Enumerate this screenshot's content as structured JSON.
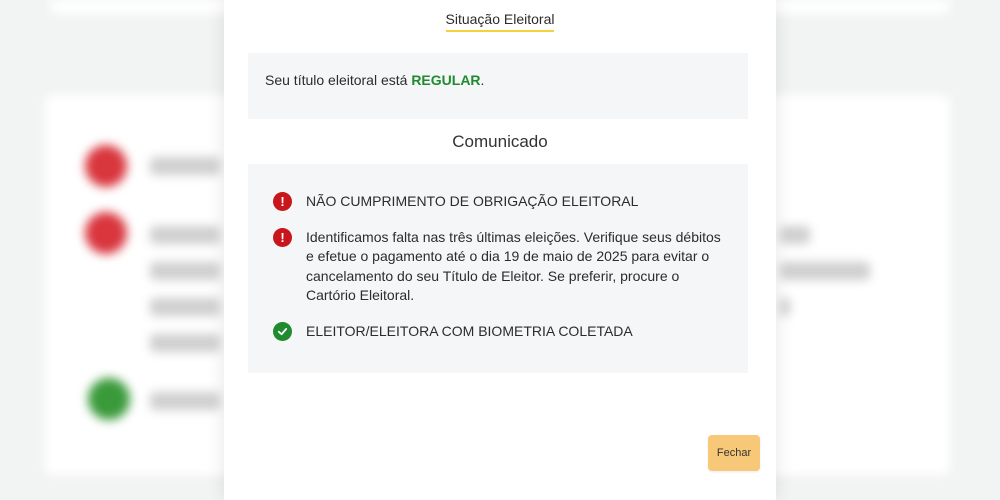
{
  "modal": {
    "title": "Situação Eleitoral",
    "status": {
      "prefix": "Seu título eleitoral está ",
      "value": "REGULAR",
      "suffix": ".",
      "value_color": "#1f8a2e"
    },
    "section_title": "Comunicado",
    "notices": [
      {
        "type": "danger",
        "icon": "exclamation-icon",
        "text": "NÃO CUMPRIMENTO DE OBRIGAÇÃO ELEITORAL"
      },
      {
        "type": "danger",
        "icon": "exclamation-icon",
        "text": "Identificamos falta nas três últimas eleições. Verifique seus débitos e efetue o pagamento até o dia 19 de maio de 2025 para evitar o cancelamento do seu Título de Eleitor. Se preferir, procure o Cartório Eleitoral."
      },
      {
        "type": "success",
        "icon": "check-icon",
        "text": "ELEITOR/ELEITORA COM BIOMETRIA COLETADA"
      }
    ],
    "close_label": "Fechar"
  },
  "colors": {
    "danger": "#c8161d",
    "success": "#1f8a2e",
    "accent_underline": "#f3d33a",
    "close_button": "#f7c877"
  }
}
